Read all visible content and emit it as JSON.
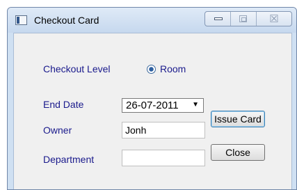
{
  "window": {
    "title": "Checkout Card",
    "close_symbol": "☒"
  },
  "form": {
    "checkout_level_label": "Checkout Level",
    "checkout_level_option": "Room",
    "end_date_label": "End Date",
    "end_date_value": "26-07-2011",
    "owner_label": "Owner",
    "owner_value": "Jonh",
    "department_label": "Department",
    "department_value": ""
  },
  "buttons": {
    "issue_card": "Issue Card",
    "close": "Close"
  }
}
